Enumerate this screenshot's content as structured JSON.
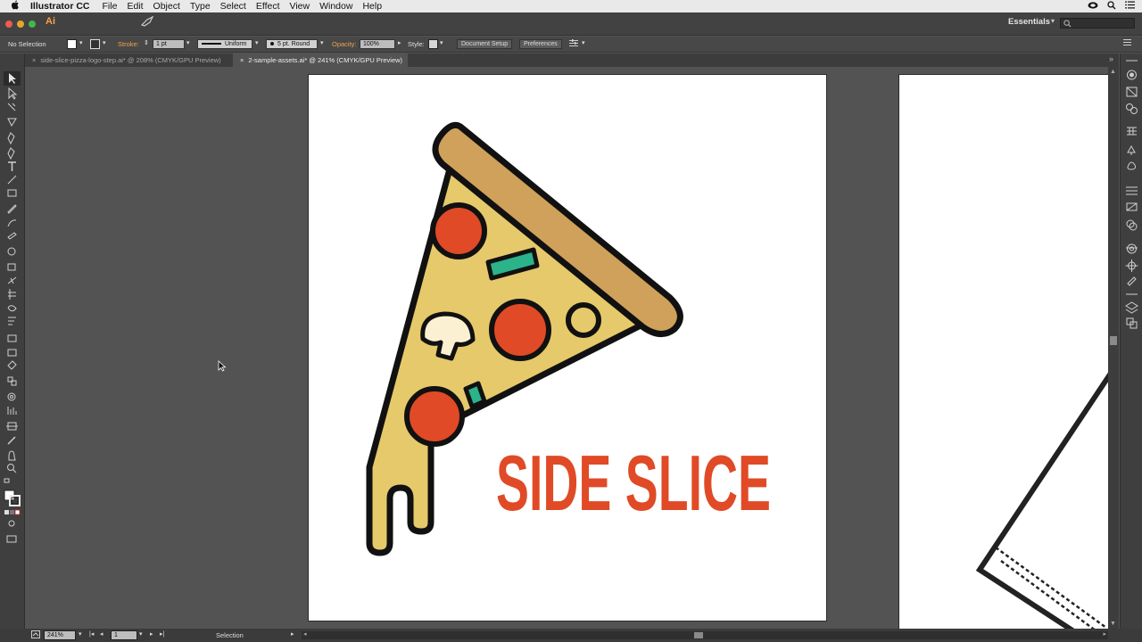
{
  "menubar": {
    "app_name": "Illustrator CC",
    "items": [
      "File",
      "Edit",
      "Object",
      "Type",
      "Select",
      "Effect",
      "View",
      "Window",
      "Help"
    ]
  },
  "appbar": {
    "logo": "Ai",
    "workspace": "Essentials"
  },
  "controlbar": {
    "selection": "No Selection",
    "stroke_label": "Stroke:",
    "stroke_weight": "1 pt",
    "profile": "Uniform",
    "brush": "5 pt. Round",
    "opacity_label": "Opacity:",
    "opacity_value": "100%",
    "style_label": "Style:",
    "document_setup": "Document Setup",
    "preferences": "Preferences"
  },
  "tabs": [
    {
      "label": "side-slice-pizza-logo-step.ai* @ 208% (CMYK/GPU Preview)",
      "active": false
    },
    {
      "label": "2-sample-assets.ai* @ 241% (CMYK/GPU Preview)",
      "active": true
    }
  ],
  "artwork": {
    "logo_text": "SIDE SLICE",
    "colors": {
      "crust": "#cfa15a",
      "cheese": "#e6c96a",
      "pepperoni": "#e04a26",
      "pepper": "#2bb38a",
      "mushroom": "#fbf1d2",
      "outline": "#111111",
      "text": "#e04a26"
    }
  },
  "statusbar": {
    "zoom": "241%",
    "artboard": "1",
    "tool": "Selection"
  }
}
